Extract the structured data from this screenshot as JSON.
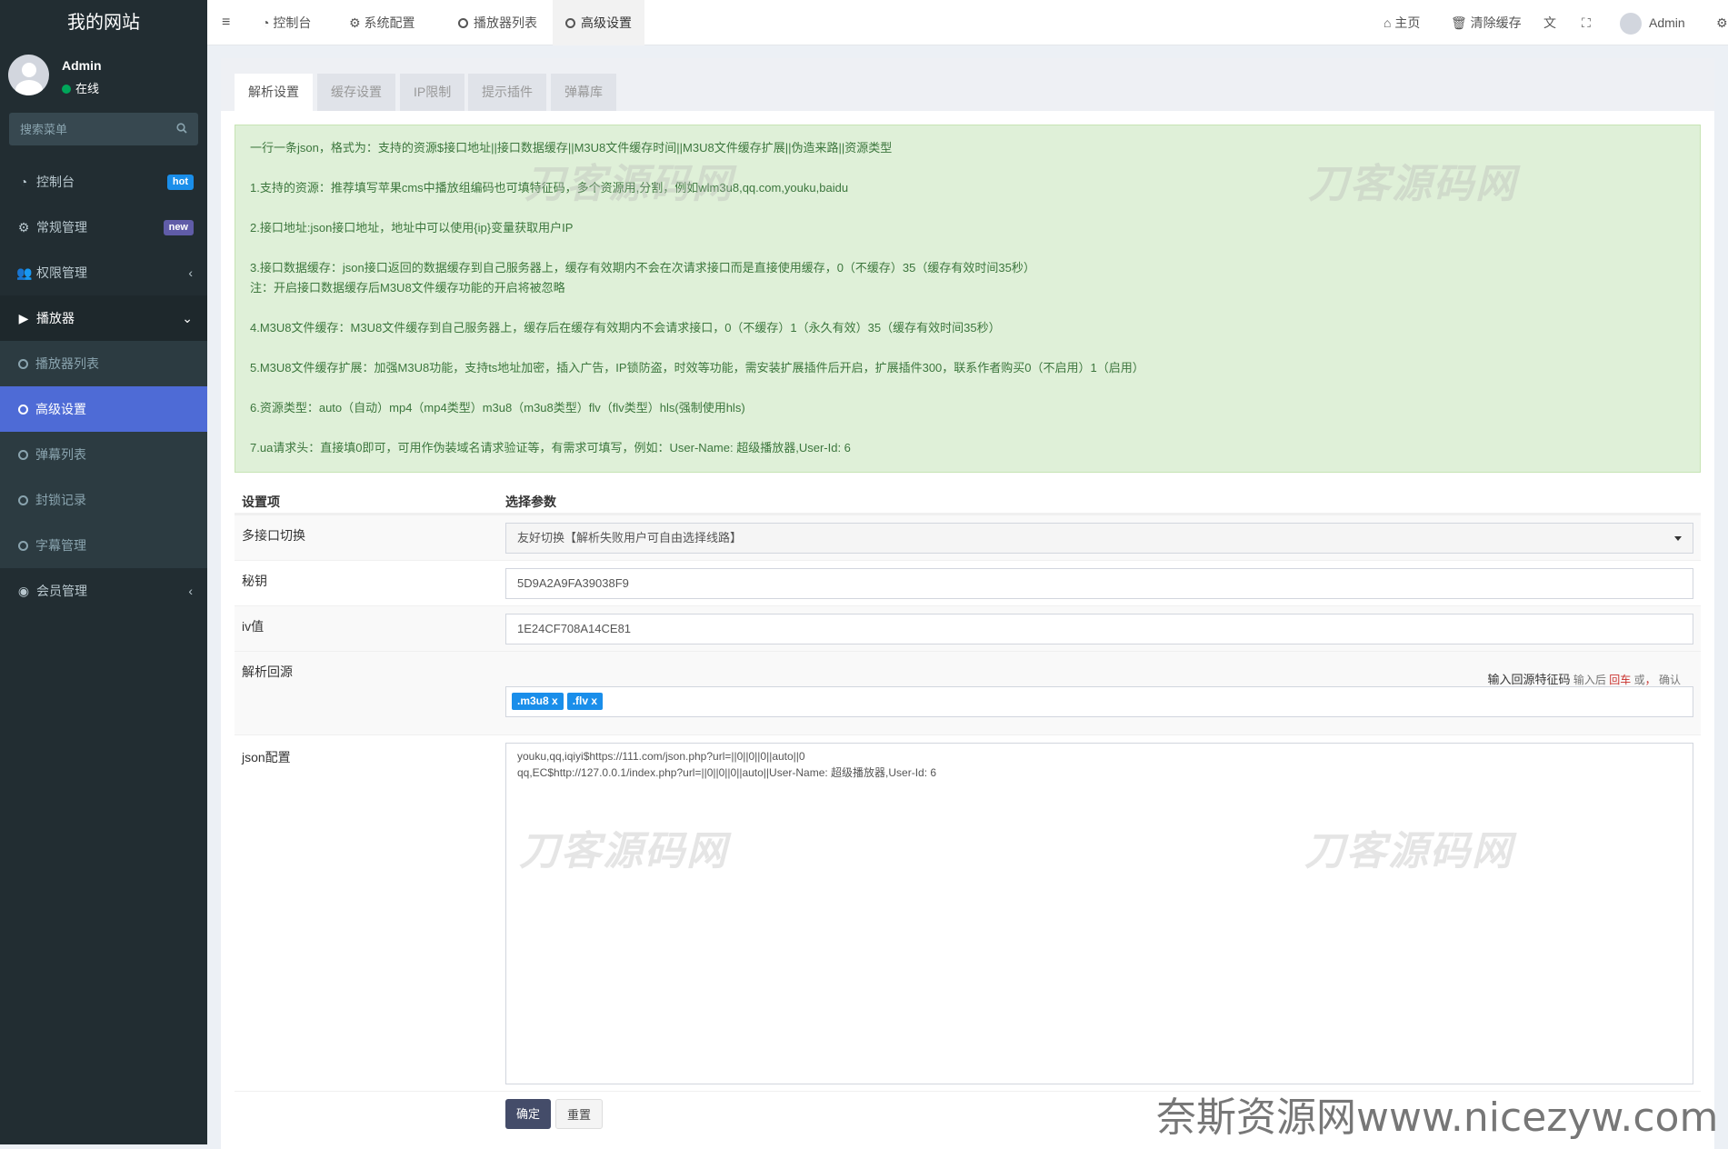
{
  "sidebar": {
    "title": "我的网站",
    "user": {
      "name": "Admin",
      "status": "在线"
    },
    "search_placeholder": "搜索菜单",
    "menu": [
      {
        "label": "控制台",
        "badge": "hot",
        "badge_color": "#1a8eea"
      },
      {
        "label": "常规管理",
        "badge": "new",
        "badge_color": "#605ca8"
      },
      {
        "label": "权限管理",
        "chevron": "‹"
      },
      {
        "label": "播放器",
        "chevron": "⌄"
      }
    ],
    "submenu": [
      "播放器列表",
      "高级设置",
      "弹幕列表",
      "封锁记录",
      "字幕管理"
    ],
    "member": {
      "label": "会员管理",
      "chevron": "‹"
    }
  },
  "topbar": {
    "tabs": [
      "控制台",
      "系统配置",
      "播放器列表",
      "高级设置"
    ],
    "right": {
      "home": "主页",
      "clear_cache": "清除缓存",
      "user": "Admin"
    }
  },
  "tabs": [
    "解析设置",
    "缓存设置",
    "IP限制",
    "提示插件",
    "弹幕库"
  ],
  "notice": [
    "一行一条json，格式为：支持的资源$接口地址||接口数据缓存||M3U8文件缓存时间||M3U8文件缓存扩展||伪造来路||资源类型",
    "1.支持的资源：推荐填写苹果cms中播放组编码也可填特征码，多个资源用,分割，例如wlm3u8,qq.com,youku,baidu",
    "2.接口地址:json接口地址，地址中可以使用{ip}变量获取用户IP",
    "3.接口数据缓存：json接口返回的数据缓存到自己服务器上，缓存有效期内不会在次请求接口而是直接使用缓存，0（不缓存）35（缓存有效时间35秒）",
    "注：开启接口数据缓存后M3U8文件缓存功能的开启将被忽略",
    "4.M3U8文件缓存：M3U8文件缓存到自己服务器上，缓存后在缓存有效期内不会请求接口，0（不缓存）1（永久有效）35（缓存有效时间35秒）",
    "5.M3U8文件缓存扩展：加强M3U8功能，支持ts地址加密，插入广告，IP锁防盗，时效等功能，需安装扩展插件后开启，扩展插件300，联系作者购买0（不启用）1（启用）",
    "6.资源类型：auto（自动）mp4（mp4类型）m3u8（m3u8类型）flv（flv类型）hls(强制使用hls)",
    "7.ua请求头：直接填0即可，可用作伪装域名请求验证等，有需求可填写，例如：User-Name: 超级播放器,User-Id: 6"
  ],
  "watermark": "刀客源码网",
  "table": {
    "head": [
      "设置项",
      "选择参数"
    ],
    "multi_label": "多接口切换",
    "multi_value": "友好切换【解析失败用户可自由选择线路】",
    "secret_label": "秘钥",
    "secret_value": "5D9A2A9FA39038F9",
    "iv_label": "iv值",
    "iv_value": "1E24CF708A14CE81",
    "source_label": "解析回源",
    "source_hint": "输入回源特征码",
    "source_hint2": "输入后",
    "source_hint3": "回车",
    "source_hint4": "或",
    "source_hint5": "，",
    "source_hint6": "确认",
    "source_tags": [
      ".m3u8  x",
      ".flv  x"
    ],
    "json_label": "json配置",
    "json_lines": [
      "youku,qq,iqiyi$https://111.com/json.php?url=||0||0||0||auto||0",
      "qq,EC$http://127.0.0.1/index.php?url=||0||0||0||auto||User-Name: 超级播放器,User-Id: 6"
    ]
  },
  "buttons": {
    "submit": "确定",
    "reset": "重置"
  },
  "footer_watermark": "奈斯资源网www.nicezyw.com",
  "colors": {
    "sidebar": "#222d32",
    "active": "#4e6bd6",
    "notice_bg": "#dff0d8",
    "notice_text": "#3c763d",
    "tag": "#1a8eea",
    "submit": "#444c69"
  }
}
